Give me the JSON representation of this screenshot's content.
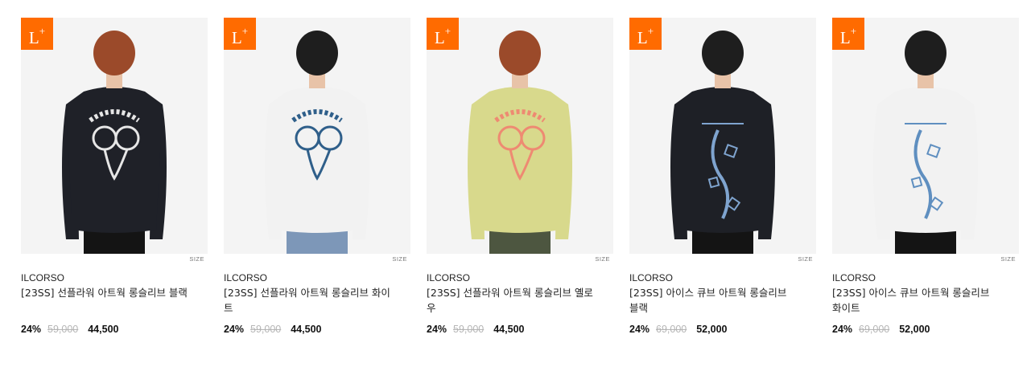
{
  "products": [
    {
      "badge": "L",
      "badge_sup": "+",
      "size_label": "SIZE",
      "brand": "ILCORSO",
      "name": "[23SS] 선플라워 아트웍 롱슬리브 블랙",
      "discount": "24%",
      "original_price": "59,000",
      "sale_price": "44,500",
      "shirt_color": "#1f2128",
      "print_color": "#e6e6e6",
      "hair_color": "#9b4a2a",
      "pants_color": "#141414"
    },
    {
      "badge": "L",
      "badge_sup": "+",
      "size_label": "SIZE",
      "brand": "ILCORSO",
      "name": "[23SS] 선플라워 아트웍 롱슬리브 화이트",
      "discount": "24%",
      "original_price": "59,000",
      "sale_price": "44,500",
      "shirt_color": "#f2f2f2",
      "print_color": "#2f5f8a",
      "hair_color": "#1e1e1e",
      "pants_color": "#7d97b8"
    },
    {
      "badge": "L",
      "badge_sup": "+",
      "size_label": "SIZE",
      "brand": "ILCORSO",
      "name": "[23SS] 선플라워 아트웍 롱슬리브 옐로우",
      "discount": "24%",
      "original_price": "59,000",
      "sale_price": "44,500",
      "shirt_color": "#d8d98c",
      "print_color": "#ee8a72",
      "hair_color": "#9b4a2a",
      "pants_color": "#4d5640"
    },
    {
      "badge": "L",
      "badge_sup": "+",
      "size_label": "SIZE",
      "brand": "ILCORSO",
      "name": "[23SS] 아이스 큐브 아트웍 롱슬리브 블랙",
      "discount": "24%",
      "original_price": "69,000",
      "sale_price": "52,000",
      "shirt_color": "#1e2026",
      "print_color": "#7fa4cf",
      "hair_color": "#1e1e1e",
      "pants_color": "#141414"
    },
    {
      "badge": "L",
      "badge_sup": "+",
      "size_label": "SIZE",
      "brand": "ILCORSO",
      "name": "[23SS] 아이스 큐브 아트웍 롱슬리브 화이트",
      "discount": "24%",
      "original_price": "69,000",
      "sale_price": "52,000",
      "shirt_color": "#f2f2f2",
      "print_color": "#5f8fc0",
      "hair_color": "#1e1e1e",
      "pants_color": "#141414"
    }
  ]
}
